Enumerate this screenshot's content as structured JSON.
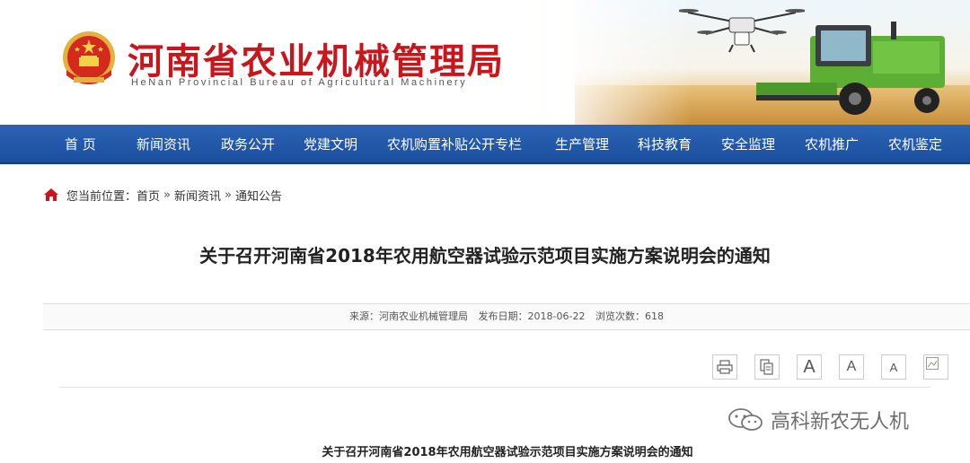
{
  "header": {
    "site_title": "河南省农业机械管理局",
    "site_subtitle": "HeNan Provincial Bureau of Agricultural Machinery",
    "emblem_icon": "national-emblem-icon",
    "banner_images": [
      "drone-icon",
      "combine-harvester-icon"
    ]
  },
  "nav": {
    "items": [
      {
        "label": "首 页"
      },
      {
        "label": "新闻资讯"
      },
      {
        "label": "政务公开"
      },
      {
        "label": "党建文明"
      },
      {
        "label": "农机购置补贴公开专栏"
      },
      {
        "label": "生产管理"
      },
      {
        "label": "科技教育"
      },
      {
        "label": "安全监理"
      },
      {
        "label": "农机推广"
      },
      {
        "label": "农机鉴定"
      }
    ],
    "background_color": "#1f55a5"
  },
  "breadcrumb": {
    "icon": "home-icon",
    "prefix": "您当前位置：",
    "items": [
      "首页",
      "新闻资讯",
      "通知公告"
    ],
    "separator": "»"
  },
  "article": {
    "title": "关于召开河南省2018年农用航空器试验示范项目实施方案说明会的通知",
    "meta": {
      "source": "来源：河南农业机械管理局",
      "date": "发布日期：2018-06-22",
      "views": "浏览次数：618"
    },
    "tools": [
      {
        "icon": "print-icon"
      },
      {
        "icon": "copy-icon"
      },
      {
        "icon": "font-large-icon",
        "label": "A"
      },
      {
        "icon": "font-medium-icon",
        "label": "A"
      },
      {
        "icon": "font-small-icon",
        "label": "A"
      },
      {
        "icon": "broken-image-icon"
      }
    ],
    "body_title": "关于召开河南省2018年农用航空器试验示范项目实施方案说明会的通知"
  },
  "watermark": {
    "icon": "wechat-icon",
    "text": "高科新农无人机"
  },
  "colors": {
    "title_red": "#c8161d",
    "nav_blue": "#1f55a5"
  }
}
